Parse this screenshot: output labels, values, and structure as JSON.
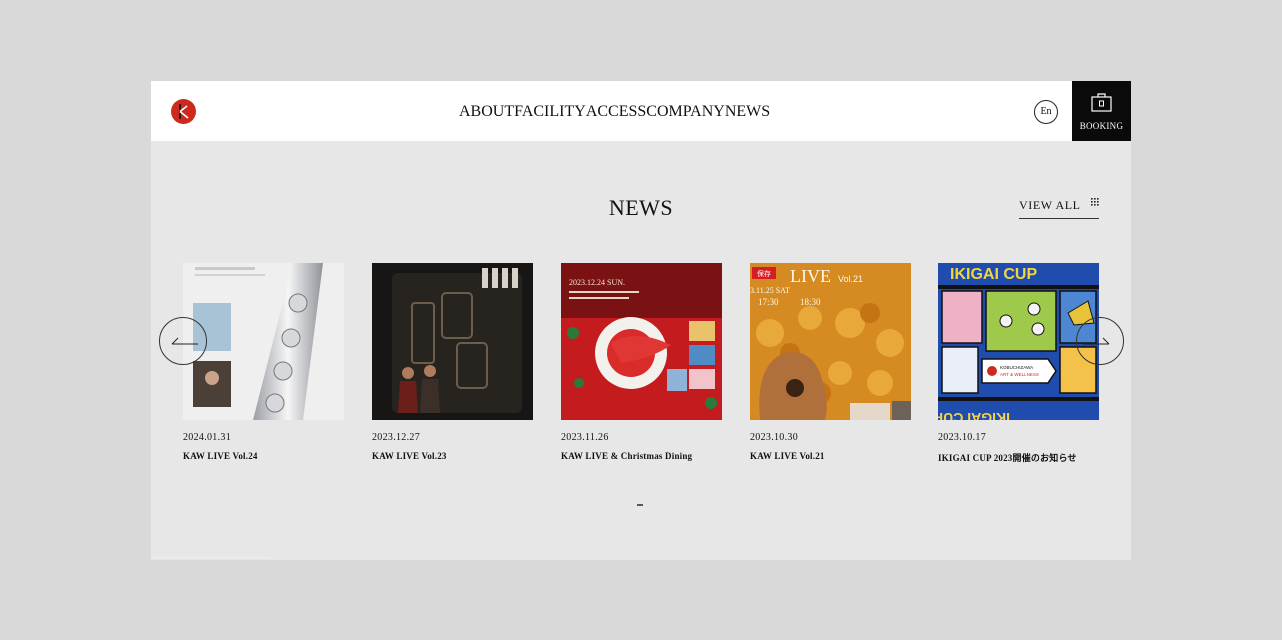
{
  "header": {
    "logo_name": "kaw-logo",
    "nav": [
      "ABOUT",
      "FACILITY",
      "ACCESS",
      "COMPANY",
      "NEWS"
    ],
    "lang_label": "En",
    "booking_label": "BOOKING"
  },
  "news": {
    "title": "NEWS",
    "view_all": "VIEW ALL",
    "items": [
      {
        "date": "2024.01.31",
        "title": "KAW LIVE Vol.24"
      },
      {
        "date": "2023.12.27",
        "title": "KAW LIVE Vol.23"
      },
      {
        "date": "2023.11.26",
        "title": "KAW LIVE & Christmas Dining"
      },
      {
        "date": "2023.10.30",
        "title": "KAW LIVE Vol.21"
      },
      {
        "date": "2023.10.17",
        "title": "IKIGAI CUP 2023開催のお知らせ"
      }
    ],
    "thumb_text": {
      "xmas_date": "2023.12.24 SUN.",
      "live_title": "LIVE",
      "live_vol": "Vol.21",
      "live_date": "3.11.25 SAT",
      "live_time": "17:30",
      "live_time2": "18:30",
      "live_badge": "保存",
      "golf_title": "IKIGAI CUP",
      "golf_sign_1": "KOBUCHIZAWA",
      "golf_sign_2": "ART & WELLNESS"
    }
  },
  "colors": {
    "brand_red": "#cc2a1f",
    "page_bg": "#e7e7e7",
    "booking_bg": "#0a0a0a"
  }
}
